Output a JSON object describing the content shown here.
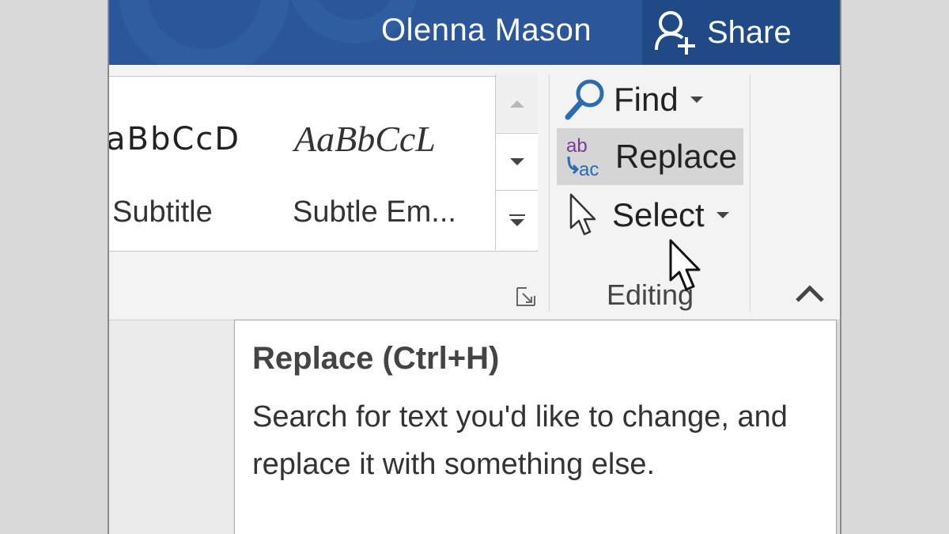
{
  "titlebar": {
    "user_name": "Olenna Mason",
    "share_label": "Share",
    "background_color": "#2b579a",
    "share_background_color": "#1f4a86"
  },
  "styles_gallery": {
    "items": [
      {
        "preview": "aBbCcD",
        "name": "Subtitle"
      },
      {
        "preview": "AaBbCcL",
        "name": "Subtle Em..."
      }
    ],
    "scroll_up_icon": "triangle-up-icon",
    "scroll_down_icon": "triangle-down-icon",
    "more_icon": "gallery-more-icon",
    "launcher_icon": "dialog-launcher-icon"
  },
  "editing": {
    "find_label": "Find",
    "replace_label": "Replace",
    "select_label": "Select",
    "group_label": "Editing",
    "replace_icon_top": "ab",
    "replace_icon_bottom": "ac",
    "find_icon": "magnifier-icon",
    "select_icon": "pointer-icon",
    "collapse_icon": "chevron-up-icon",
    "hover_color": "#d5d5d5"
  },
  "tooltip": {
    "title": "Replace (Ctrl+H)",
    "description": "Search for text you'd like to change, and replace it with something else."
  }
}
